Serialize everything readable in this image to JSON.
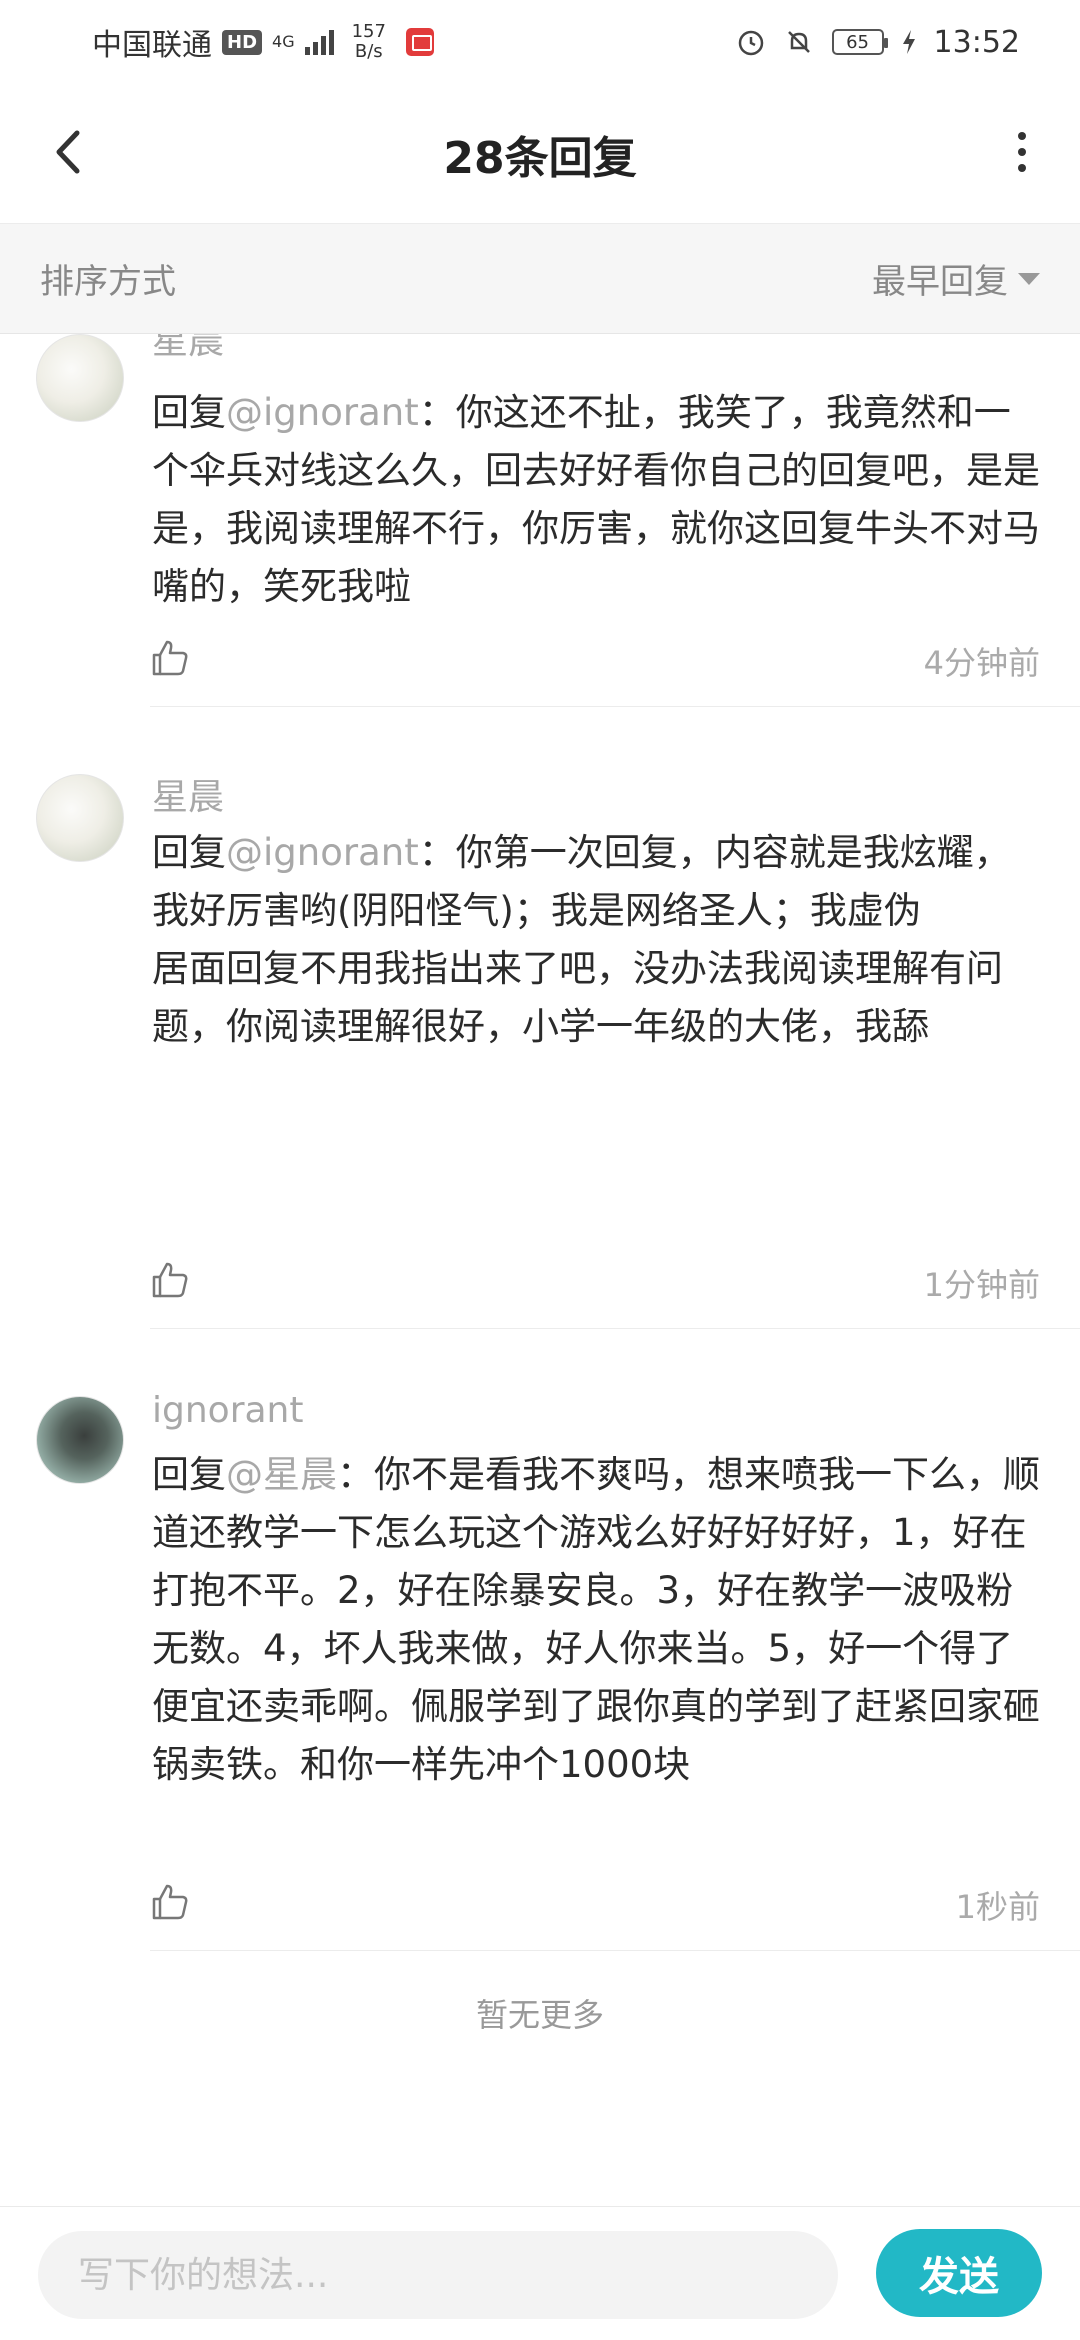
{
  "status_bar": {
    "carrier": "中国联通",
    "hd": "HD",
    "network": "4G",
    "speed_value": "157",
    "speed_unit": "B/s",
    "battery": "65",
    "time": "13:52"
  },
  "header": {
    "title": "28条回复"
  },
  "sort": {
    "label": "排序方式",
    "selected": "最早回复"
  },
  "comments": [
    {
      "user": "星晨",
      "reply_prefix": "回复",
      "mention": "@ignorant",
      "text": "：你这还不扯，我笑了，我竟然和一个伞兵对线这么久，回去好好看你自己的回复吧，是是是，我阅读理解不行，你厉害，就你这回复牛头不对马嘴的，笑死我啦",
      "time": "4分钟前"
    },
    {
      "user": "星晨",
      "reply_prefix": "回复",
      "mention": "@ignorant",
      "text": "：你第一次回复，内容就是我炫耀，我好厉害哟(阴阳怪气)；我是网络圣人；我虚伪\n居面回复不用我指出来了吧，没办法我阅读理解有问题，你阅读理解很好，小学一年级的大佬，我舔",
      "time": "1分钟前"
    },
    {
      "user": "ignorant",
      "reply_prefix": "回复",
      "mention": "@星晨",
      "text": "：你不是看我不爽吗，想来喷我一下么，顺道还教学一下怎么玩这个游戏么好好好好好，1，好在打抱不平。2，好在除暴安良。3，好在教学一波吸粉无数。4，坏人我来做，好人你来当。5，好一个得了便宜还卖乖啊。佩服学到了跟你真的学到了赶紧回家砸锅卖铁。和你一样先冲个1000块",
      "time": "1秒前"
    }
  ],
  "footer": {
    "no_more": "暂无更多",
    "input_placeholder": "写下你的想法...",
    "send": "发送"
  },
  "colors": {
    "accent": "#22b8c6",
    "muted_text": "#a8a8a8"
  },
  "icons": {
    "back": "chevron-left-icon",
    "more": "more-vertical-icon",
    "like": "thumbs-up-icon",
    "sort_caret": "caret-down-icon"
  }
}
